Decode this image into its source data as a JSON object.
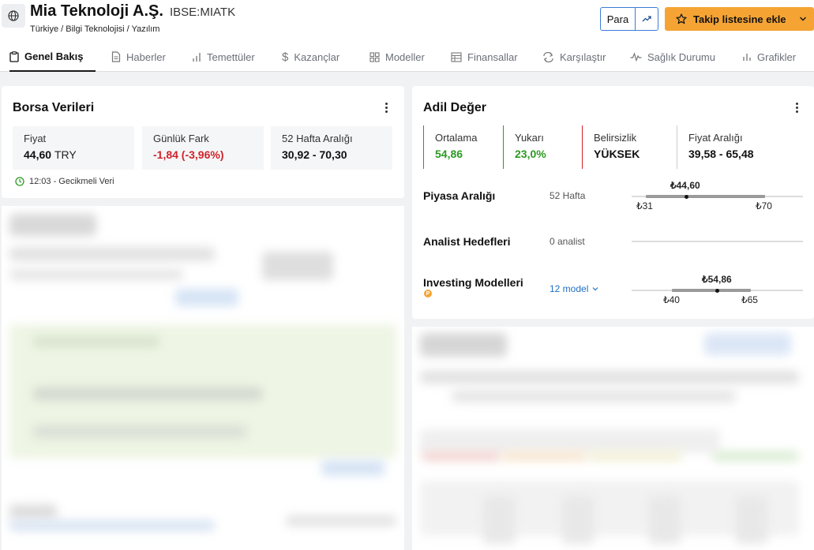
{
  "header": {
    "company_name": "Mia Teknoloji A.Ş.",
    "ticker": "IBSE:MIATK",
    "breadcrumb": "Türkiye / Bilgi Teknolojisi / Yazılım",
    "para_button": "Para",
    "watchlist_button": "Takip listesine ekle"
  },
  "tabs": [
    {
      "label": "Genel Bakış",
      "icon": "clipboard-icon",
      "active": true
    },
    {
      "label": "Haberler",
      "icon": "document-icon"
    },
    {
      "label": "Temettüler",
      "icon": "dividend-icon"
    },
    {
      "label": "Kazançlar",
      "icon": "dollar-icon"
    },
    {
      "label": "Modeller",
      "icon": "grid-icon"
    },
    {
      "label": "Finansallar",
      "icon": "table-icon"
    },
    {
      "label": "Karşılaştır",
      "icon": "compare-icon"
    },
    {
      "label": "Sağlık Durumu",
      "icon": "pulse-icon"
    },
    {
      "label": "Grafikler",
      "icon": "bar-chart-icon"
    }
  ],
  "exchange_data": {
    "title": "Borsa Verileri",
    "stats": [
      {
        "label": "Fiyat",
        "value": "44,60",
        "unit": "TRY"
      },
      {
        "label": "Günlük Fark",
        "value": "-1,84 (-3,96%)"
      },
      {
        "label": "52 Hafta Aralığı",
        "value": "30,92 - 70,30"
      }
    ],
    "delayed_note": "12:03 - Gecikmeli Veri"
  },
  "fair_value": {
    "title": "Adil Değer",
    "boxes": [
      {
        "label": "Ortalama",
        "value": "54,86",
        "accent": "#2c9a22"
      },
      {
        "label": "Yukarı",
        "value": "23,0%",
        "accent": "#2c9a22"
      },
      {
        "label": "Belirsizlik",
        "value": "YÜKSEK",
        "accent": "#d0232b"
      },
      {
        "label": "Fiyat Aralığı",
        "value": "39,58 - 65,48",
        "accent": "#cccccc"
      }
    ],
    "market_range": {
      "label": "Piyasa Aralığı",
      "sub": "52 Hafta",
      "current": "₺44,60",
      "low": "₺31",
      "high": "₺70"
    },
    "analyst_targets": {
      "label": "Analist Hedefleri",
      "sub": "0 analist"
    },
    "investing_models": {
      "label": "Investing Modelleri",
      "link": "12 model",
      "current": "₺54,86",
      "low": "₺40",
      "high": "₺65"
    }
  },
  "colors": {
    "accent_orange": "#f5a434",
    "link_blue": "#1f6fc5",
    "positive": "#2c9a22",
    "negative": "#d0232b"
  }
}
